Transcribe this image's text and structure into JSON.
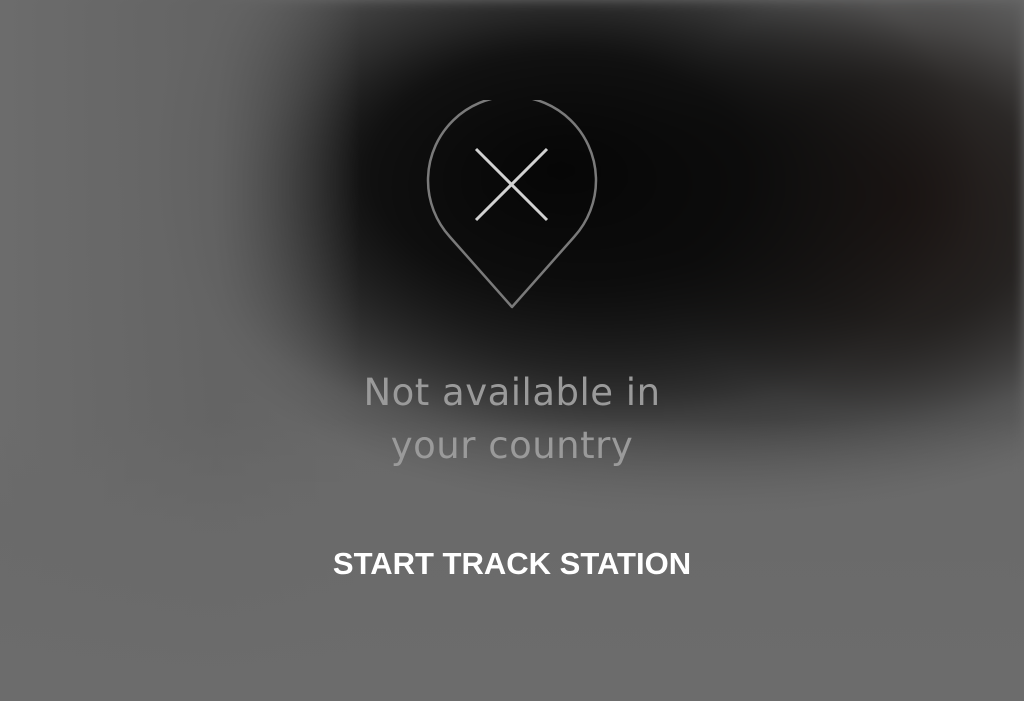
{
  "message": {
    "line1": "Not available in",
    "line2": "your country"
  },
  "actions": {
    "start_track_station": "START TRACK STATION"
  },
  "icons": {
    "status_icon": "location-pin-unavailable-icon",
    "mark": "x-mark-icon"
  },
  "colors": {
    "background": "#6a6a6a",
    "message_text": "#9a9a9a",
    "button_text": "#ffffff",
    "icon_stroke": "#7a7a7a"
  }
}
